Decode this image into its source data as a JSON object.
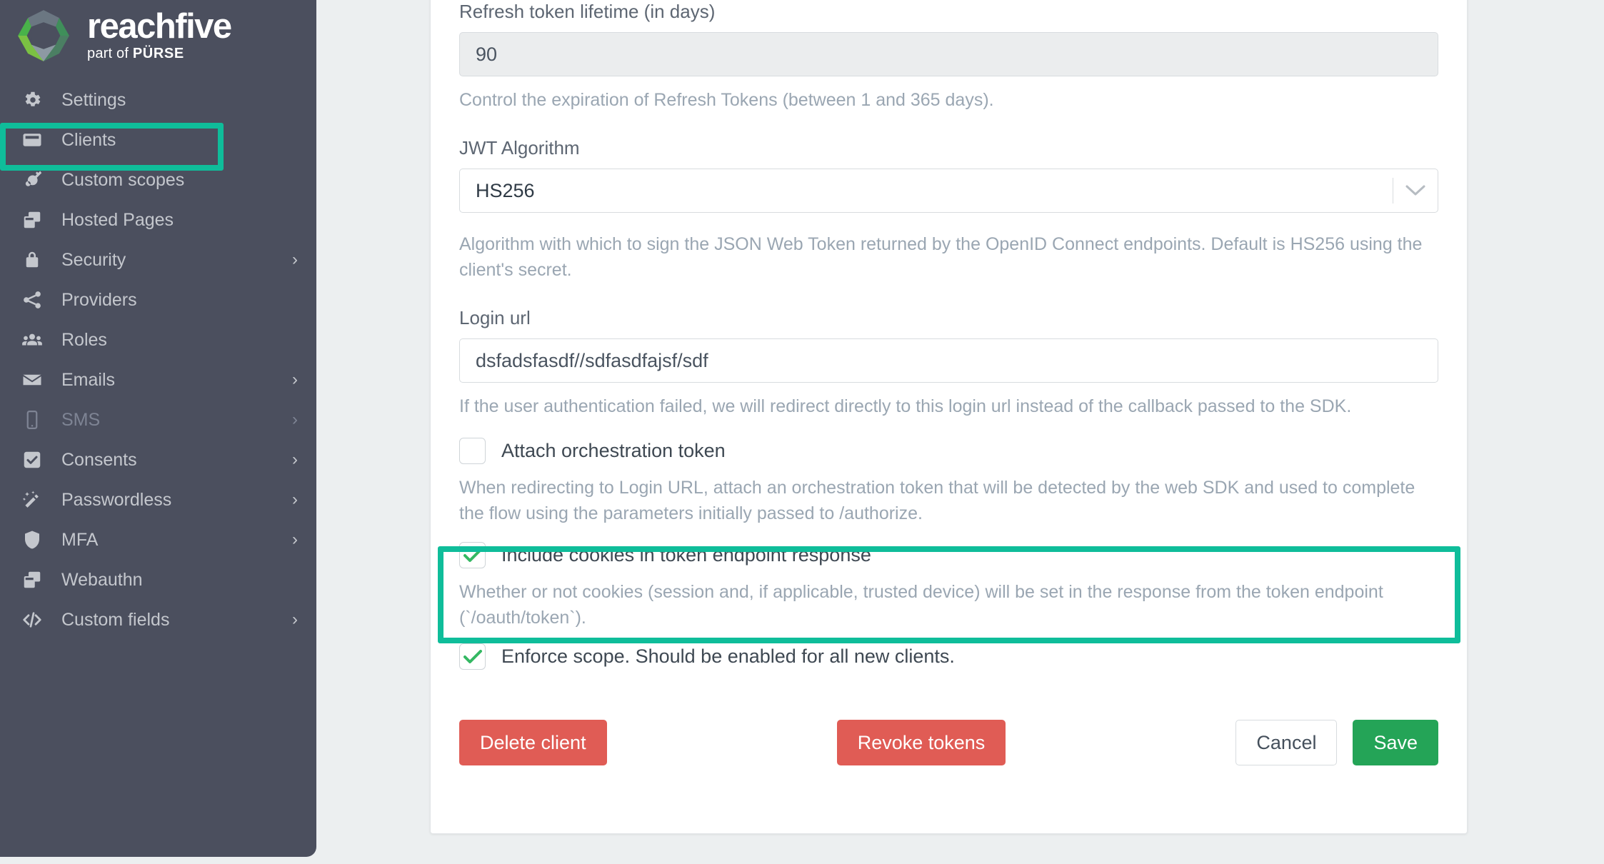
{
  "brand": {
    "name": "reachfive",
    "tagline_prefix": "part of ",
    "tagline_brand": "PÜRSE",
    "logo_icon": "reachfive-ring-logo"
  },
  "sidebar": {
    "items": [
      {
        "label": "Settings",
        "icon": "gear-icon",
        "chevron": "",
        "muted": false
      },
      {
        "label": "Clients",
        "icon": "card-icon",
        "chevron": "",
        "muted": false
      },
      {
        "label": "Custom scopes",
        "icon": "key-icon",
        "chevron": "",
        "muted": false
      },
      {
        "label": "Hosted Pages",
        "icon": "windows-icon",
        "chevron": "",
        "muted": false
      },
      {
        "label": "Security",
        "icon": "lock-icon",
        "chevron": "›",
        "muted": false
      },
      {
        "label": "Providers",
        "icon": "share-icon",
        "chevron": "",
        "muted": false
      },
      {
        "label": "Roles",
        "icon": "users-icon",
        "chevron": "",
        "muted": false
      },
      {
        "label": "Emails",
        "icon": "envelope-icon",
        "chevron": "›",
        "muted": false
      },
      {
        "label": "SMS",
        "icon": "mobile-icon",
        "chevron": "›",
        "muted": true
      },
      {
        "label": "Consents",
        "icon": "checkbox-icon",
        "chevron": "›",
        "muted": false
      },
      {
        "label": "Passwordless",
        "icon": "magic-wand-icon",
        "chevron": "›",
        "muted": false
      },
      {
        "label": "MFA",
        "icon": "shield-icon",
        "chevron": "›",
        "muted": false
      },
      {
        "label": "Webauthn",
        "icon": "windows-icon",
        "chevron": "",
        "muted": false
      },
      {
        "label": "Custom fields",
        "icon": "code-icon",
        "chevron": "›",
        "muted": false
      }
    ]
  },
  "highlights": {
    "color": "#0fbd9a",
    "targets": [
      "sidebar-item-clients",
      "include-cookies-block"
    ]
  },
  "form": {
    "refresh_token": {
      "label": "Refresh token lifetime (in days)",
      "value": "90",
      "helper": "Control the expiration of Refresh Tokens (between 1 and 365 days)."
    },
    "jwt_algorithm": {
      "label": "JWT Algorithm",
      "value": "HS256",
      "caret_icon": "chevron-down-icon",
      "helper": "Algorithm with which to sign the JSON Web Token returned by the OpenID Connect endpoints. Default is HS256 using the client's secret."
    },
    "login_url": {
      "label": "Login url",
      "value": "dsfadsfasdf//sdfasdfajsf/sdf",
      "helper": "If the user authentication failed, we will redirect directly to this login url instead of the callback passed to the SDK."
    },
    "attach_orchestration_token": {
      "label": "Attach orchestration token",
      "checked": false,
      "helper": "When redirecting to Login URL, attach an orchestration token that will be detected by the web SDK and used to complete the flow using the parameters initially passed to /authorize."
    },
    "include_cookies": {
      "label": "Include cookies in token endpoint response",
      "checked": true,
      "helper": "Whether or not cookies (session and, if applicable, trusted device) will be set in the response from the token endpoint (`/oauth/token`)."
    },
    "enforce_scope": {
      "label": "Enforce scope. Should be enabled for all new clients.",
      "checked": true
    }
  },
  "actions": {
    "delete_client": "Delete client",
    "revoke_tokens": "Revoke tokens",
    "cancel": "Cancel",
    "save": "Save"
  },
  "colors": {
    "sidebar_bg": "#4b4f5e",
    "page_bg": "#eceff0",
    "accent_highlight": "#0fbd9a",
    "danger": "#e05c55",
    "success": "#24a457",
    "check_green": "#35b863"
  }
}
